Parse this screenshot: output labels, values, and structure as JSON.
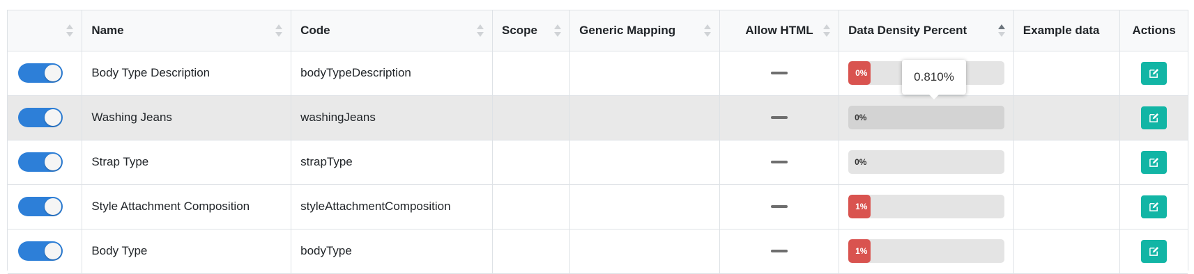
{
  "table": {
    "headers": {
      "select": "",
      "name": "Name",
      "code": "Code",
      "scope": "Scope",
      "generic_mapping": "Generic Mapping",
      "allow_html": "Allow HTML",
      "data_density": "Data Density Percent",
      "example_data": "Example data",
      "actions": "Actions"
    },
    "sort": {
      "column": "Data Density Percent",
      "direction": "ascending"
    },
    "rows": [
      {
        "enabled": true,
        "name": "Body Type Description",
        "code": "bodyTypeDescription",
        "scope": "",
        "generic_mapping": "",
        "allow_html": "–",
        "density_label": "0%",
        "density_value": 0.0081,
        "example_data": ""
      },
      {
        "enabled": true,
        "name": "Washing Jeans",
        "code": "washingJeans",
        "scope": "",
        "generic_mapping": "",
        "allow_html": "–",
        "density_label": "0%",
        "density_value": 0,
        "example_data": "",
        "hovered": true
      },
      {
        "enabled": true,
        "name": "Strap Type",
        "code": "strapType",
        "scope": "",
        "generic_mapping": "",
        "allow_html": "–",
        "density_label": "0%",
        "density_value": 0,
        "example_data": ""
      },
      {
        "enabled": true,
        "name": "Style Attachment Composition",
        "code": "styleAttachmentComposition",
        "scope": "",
        "generic_mapping": "",
        "allow_html": "–",
        "density_label": "1%",
        "density_value": 1,
        "example_data": ""
      },
      {
        "enabled": true,
        "name": "Body Type",
        "code": "bodyType",
        "scope": "",
        "generic_mapping": "",
        "allow_html": "–",
        "density_label": "1%",
        "density_value": 1,
        "example_data": ""
      }
    ]
  },
  "tooltip": {
    "text": "0.810%"
  },
  "colors": {
    "toggle_on": "#2d7fd8",
    "edit_button": "#12b5a5",
    "density_low": "#d9534f",
    "row_hover": "#e9e9e9"
  },
  "icons": {
    "edit": "edit-icon",
    "sort": "sort-icon",
    "allow_html_none": "dash-icon"
  }
}
